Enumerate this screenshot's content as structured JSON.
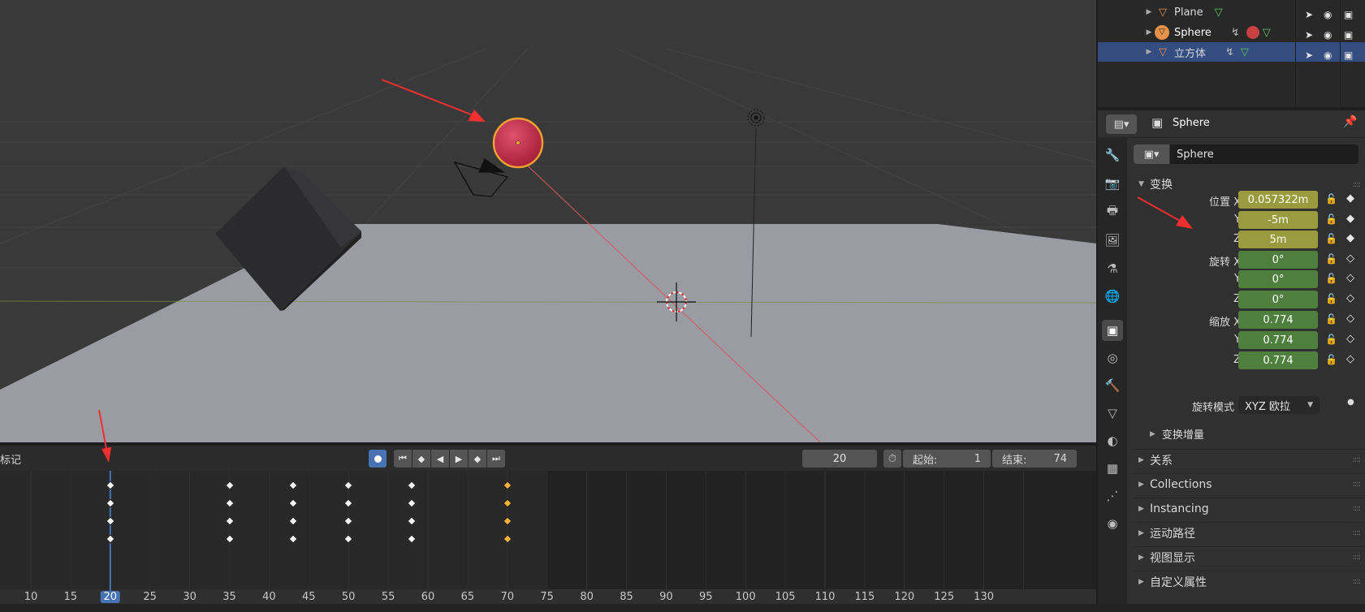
{
  "outliner": {
    "rows": [
      {
        "name": "Plane",
        "selected": false
      },
      {
        "name": "Sphere",
        "selected": false
      },
      {
        "name": "立方体",
        "selected": true
      }
    ]
  },
  "properties": {
    "header_title": "Sphere",
    "object_name": "Sphere",
    "transform_panel": "变换",
    "location_label": "位置 X",
    "rotation_label": "旋转 X",
    "scale_label": "缩放 X",
    "y_label": "Y",
    "z_label": "Z",
    "location": {
      "x": "0.057322m",
      "y": "-5m",
      "z": "5m"
    },
    "rotation": {
      "x": "0°",
      "y": "0°",
      "z": "0°"
    },
    "scale": {
      "x": "0.774",
      "y": "0.774",
      "z": "0.774"
    },
    "rotation_mode_label": "旋转模式",
    "rotation_mode_value": "XYZ 欧拉",
    "delta_transform": "变换增量",
    "collapsed_panels": [
      "关系",
      "Collections",
      "Instancing",
      "运动路径",
      "视图显示",
      "自定义属性"
    ]
  },
  "timeline": {
    "marker_label": "标记",
    "current_frame": "20",
    "start_label": "起始:",
    "start_value": "1",
    "end_label": "结束:",
    "end_value": "74",
    "ruler": [
      "10",
      "15",
      "20",
      "25",
      "30",
      "35",
      "40",
      "45",
      "50",
      "55",
      "60",
      "65",
      "70",
      "75",
      "80",
      "85",
      "90",
      "95",
      "100",
      "105",
      "110",
      "115",
      "120",
      "125",
      "130"
    ],
    "keyframes": [
      20,
      35,
      43,
      50,
      58,
      70
    ],
    "selected_keyframe": 70
  },
  "colors": {
    "selected_row": "#334d80",
    "keyed_field": "#9a9a3e",
    "animated_field": "#4f7f3d",
    "accent": "#4772b3",
    "keyframe_selected": "#f0b23c"
  }
}
